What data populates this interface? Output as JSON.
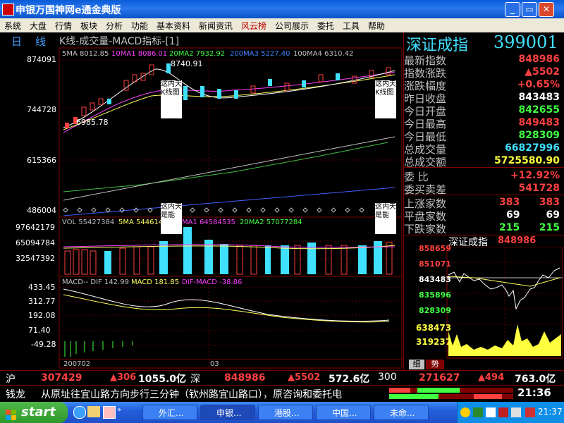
{
  "window": {
    "title": "申银万国神网e通金典版",
    "buttons": {
      "minimize": "_",
      "restore": "▭",
      "close": "✕"
    }
  },
  "menu": [
    "系统",
    "大盘",
    "行情",
    "板块",
    "分析",
    "功能",
    "基本资料",
    "新闻资讯",
    "风云榜",
    "公司展示",
    "委托",
    "工具",
    "帮助"
  ],
  "chart_header": {
    "period": "日",
    "period2": "线",
    "title": "K线-成交量-MACD指标-[1]"
  },
  "price_panel": {
    "ma_labels": [
      "5MA 8012.85",
      "10MA1 8086.01",
      "20MA2 7932.92",
      "200MA3 5227.40",
      "100MA4 6310.42"
    ],
    "y_ticks": [
      "874091",
      "744728",
      "615366",
      "486004"
    ],
    "high_label": "8740.91",
    "low_label": "6985.78",
    "notes": [
      "这内天K线图",
      "这内天K线图"
    ]
  },
  "volume_panel": {
    "labels": [
      "VOL 55427384",
      "5MA 544614",
      "MA1 64584535",
      "20MA2 57077284"
    ],
    "y_ticks": [
      "97642179",
      "65094784",
      "32547392"
    ],
    "notes": [
      "这内天是能",
      "这内天是能"
    ]
  },
  "macd_panel": {
    "labels": [
      "MACD-- DIF 142.99",
      "MACD 181.85",
      "DIF-MACD -38.86"
    ],
    "y_ticks": [
      "433.45",
      "312.77",
      "192.08",
      "71.40",
      "-49.28"
    ]
  },
  "x_axis": [
    "200702",
    "03"
  ],
  "quote": {
    "title": "深证成指",
    "code": "399001",
    "rows": [
      {
        "label": "最新指数",
        "value": "848986",
        "color": "#ff4040"
      },
      {
        "label": "指数涨跌",
        "value": "▲5502",
        "color": "#ff4040"
      },
      {
        "label": "涨跌幅度",
        "value": "+0.65%",
        "color": "#ff4040"
      },
      {
        "label": "昨日收盘",
        "value": "843483",
        "color": "#ffffff"
      },
      {
        "label": "今日开盘",
        "value": "842655",
        "color": "#40ff40"
      },
      {
        "label": "今日最高",
        "value": "849483",
        "color": "#ff4040"
      },
      {
        "label": "今日最低",
        "value": "828309",
        "color": "#40ff40"
      },
      {
        "label": "总成交量",
        "value": "66827996",
        "color": "#40e0ff"
      },
      {
        "label": "总成交额",
        "value": "5725580.90",
        "color": "#ffff40"
      }
    ],
    "rows2": [
      {
        "label": "委    比",
        "value": "+12.92%",
        "color": "#ff4040"
      },
      {
        "label": "委买卖差",
        "value": "541728",
        "color": "#ff4040"
      }
    ],
    "breadth": [
      {
        "label": "上涨家数",
        "v1": "383",
        "v2": "383",
        "color": "#ff4040"
      },
      {
        "label": "平盘家数",
        "v1": "69",
        "v2": "69",
        "color": "#ffffff"
      },
      {
        "label": "下跌家数",
        "v1": "215",
        "v2": "215",
        "color": "#40ff40"
      }
    ],
    "mini_title": "深证成指",
    "mini_value": "848986",
    "mini_ticks": [
      "858659",
      "851071",
      "843483",
      "835896",
      "828309"
    ],
    "mini_vol_ticks": [
      "638473",
      "319237"
    ],
    "tabs": [
      "细",
      "势"
    ]
  },
  "status1": {
    "sh": "沪",
    "sh_index": "307429",
    "sh_change": "▲306",
    "sh_amount": "1055.0亿",
    "sz": "深",
    "sz_index": "848986",
    "sz_change": "▲5502",
    "sz_amount": "572.6亿",
    "c300": "300",
    "c300_index": "271627",
    "c300_change": "▲494",
    "c300_amount": "763.0亿"
  },
  "status2": {
    "speaker": "钱龙",
    "marquee": "从原址往宜山路方向步行三分钟（钦州路宜山路口），原咨询和委托电",
    "time": "21:36"
  },
  "taskbar": {
    "start": "start",
    "tasks": [
      "外汇...",
      "申银...",
      "港股...",
      "中国...",
      "未命..."
    ],
    "clock": "21:37"
  }
}
